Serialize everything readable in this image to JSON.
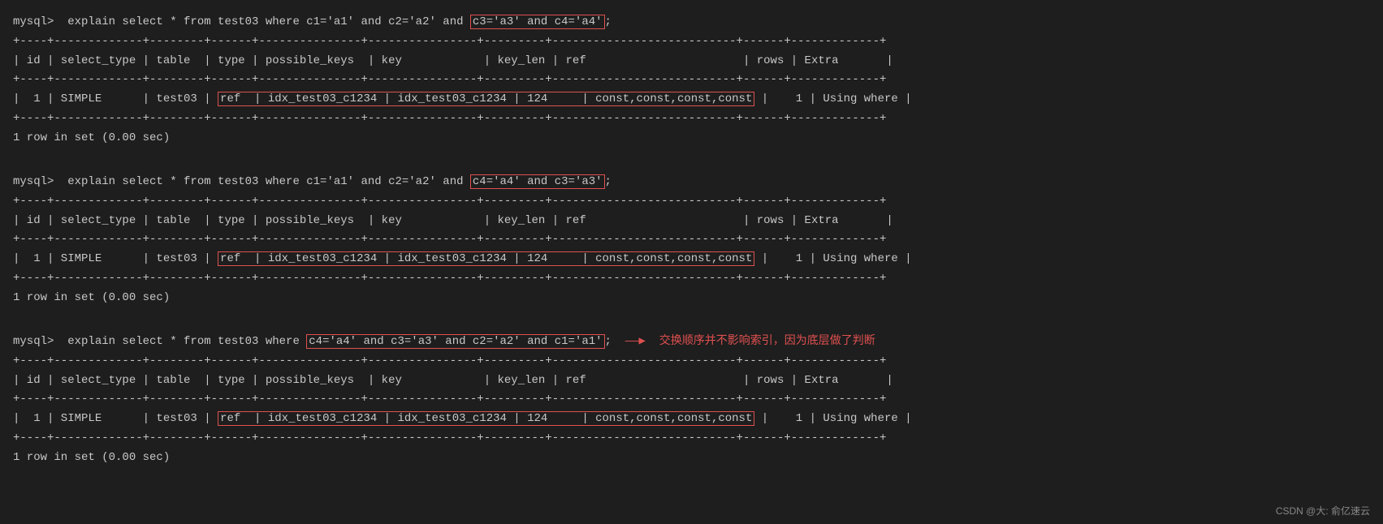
{
  "terminal": {
    "blocks": [
      {
        "id": "block1",
        "prompt": "mysql> explain select * from test03 where c1='a1' and c2='a2' and ",
        "highlight1": "c3='a3' and c4='a4'",
        "prompt_end": ";",
        "separator1": "+----+-------------+--------+------+---------------+----------------+---------+---------------------------+------+-------------+",
        "header": "| id | select_type | table  | type | possible_keys  | key            | key_len | ref                       | rows | Extra       |",
        "separator2": "+----+-------------+--------+------+---------------+----------------+---------+---------------------------+------+-------------+",
        "data_prefix": "|  1 | SIMPLE      | test03 | ",
        "data_highlight": "ref  | idx_test03_c1234 | idx_test03_c1234 | 124     | const,const,const,const",
        "data_suffix": " |    1 | Using where |",
        "separator3": "+----+-------------+--------+------+---------------+----------------+---------+---------------------------+------+-------------+",
        "row_count": "1 row in set (0.00 sec)"
      },
      {
        "id": "block2",
        "prompt": "mysql> explain select * from test03 where c1='a1' and c2='a2' and ",
        "highlight1": "c4='a4' and c3='a3'",
        "prompt_end": ";",
        "separator1": "+----+-------------+--------+------+---------------+----------------+---------+---------------------------+------+-------------+",
        "header": "| id | select_type | table  | type | possible_keys  | key            | key_len | ref                       | rows | Extra       |",
        "separator2": "+----+-------------+--------+------+---------------+----------------+---------+---------------------------+------+-------------+",
        "data_prefix": "|  1 | SIMPLE      | test03 | ",
        "data_highlight": "ref  | idx_test03_c1234 | idx_test03_c1234 | 124     | const,const,const,const",
        "data_suffix": " |    1 | Using where |",
        "separator3": "+----+-------------+--------+------+---------------+----------------+---------+---------------------------+------+-------------+",
        "row_count": "1 row in set (0.00 sec)"
      },
      {
        "id": "block3",
        "prompt": "mysql> explain select * from test03 where ",
        "highlight1": "c4='a4' and c3='a3' and c2='a2' and c1='a1'",
        "prompt_end": ";",
        "arrow": "——▶",
        "annotation": "交换顺序并不影响索引，因为底层做了判断",
        "separator1": "+----+-------------+--------+------+---------------+----------------+---------+---------------------------+------+-------------+",
        "header": "| id | select_type | table  | type | possible_keys  | key            | key_len | ref                       | rows | Extra       |",
        "separator2": "+----+-------------+--------+------+---------------+----------------+---------+---------------------------+------+-------------+",
        "data_prefix": "|  1 | SIMPLE      | test03 | ",
        "data_highlight": "ref  | idx_test03_c1234 | idx_test03_c1234 | 124     | const,const,const,const",
        "data_suffix": " |    1 | Using where |",
        "separator3": "+----+-------------+--------+------+---------------+----------------+---------+---------------------------+------+-------------+",
        "row_count": "1 row in set (0.00 sec)"
      }
    ],
    "footer": "CSDN @大: 俞亿速云"
  }
}
